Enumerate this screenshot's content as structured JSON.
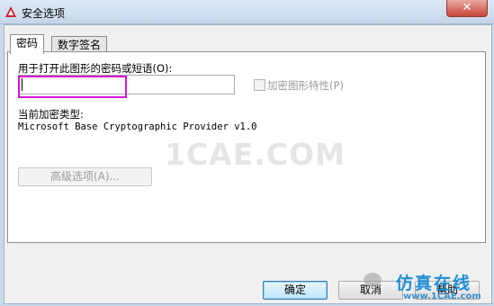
{
  "window": {
    "title": "安全选项",
    "close_symbol": "✕"
  },
  "tabs": [
    {
      "label": "密码",
      "active": true
    },
    {
      "label": "数字签名",
      "active": false
    }
  ],
  "password_section": {
    "prompt_label": "用于打开此图形的密码或短语(O):",
    "input_value": "",
    "encrypt_props_label": "加密图形特性(P)",
    "encrypt_props_checked": false
  },
  "encryption": {
    "type_label": "当前加密类型:",
    "type_value": "Microsoft Base Cryptographic Provider v1.0"
  },
  "advanced_button": "高级选项(A)...",
  "footer": {
    "ok_label": "确定",
    "cancel_label": "取消",
    "help_label": "帮助"
  },
  "watermark": {
    "center": "1CAE.COM",
    "brand": "仿真在线",
    "brand_url": "www.1CAE.com"
  },
  "colors": {
    "highlight": "#d418d4",
    "accent": "#1f8fd6"
  }
}
